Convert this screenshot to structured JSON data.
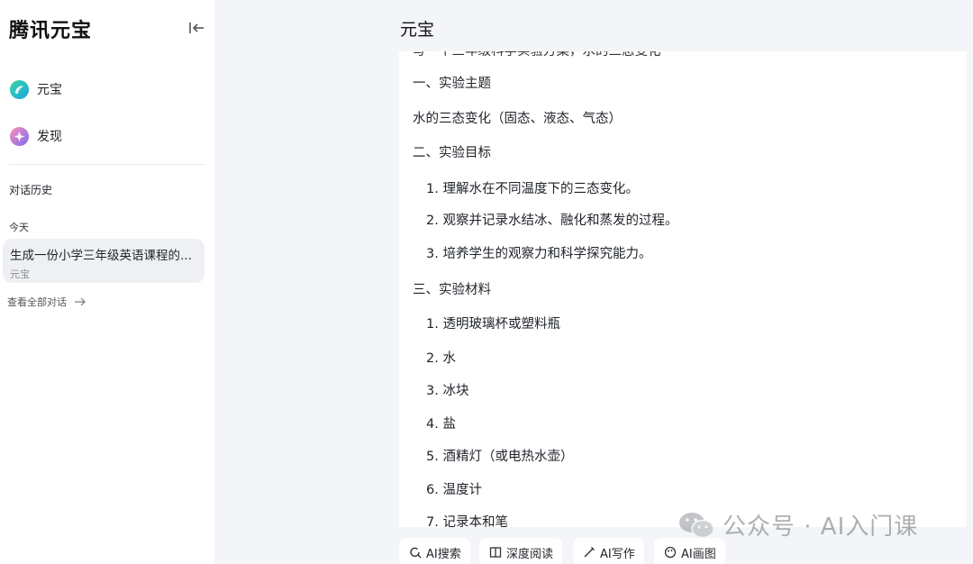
{
  "sidebar": {
    "brand": "腾讯元宝",
    "nav": [
      {
        "label": "元宝"
      },
      {
        "label": "发现"
      }
    ],
    "history_title": "对话历史",
    "today_label": "今天",
    "history_items": [
      {
        "title": "生成一份小学三年级英语课程的...",
        "subtitle": "元宝"
      }
    ],
    "view_all": "查看全部对话"
  },
  "main": {
    "title": "元宝",
    "doc": {
      "cut_line": "写一个三年级科学实验方案，水的三态变化",
      "lines": [
        "一、实验主题",
        "水的三态变化（固态、液态、气态）",
        "二、实验目标",
        "1. 理解水在不同温度下的三态变化。",
        "2. 观察并记录水结冰、融化和蒸发的过程。",
        "3. 培养学生的观察力和科学探究能力。",
        "三、实验材料",
        "1. 透明玻璃杯或塑料瓶",
        "2. 水",
        "3. 冰块",
        "4. 盐",
        "5. 酒精灯（或电热水壶）",
        "6. 温度计",
        "7. 记录本和笔"
      ]
    },
    "tools": [
      {
        "label": "AI搜索",
        "icon": "search-refresh-icon"
      },
      {
        "label": "深度阅读",
        "icon": "book-icon"
      },
      {
        "label": "AI写作",
        "icon": "pen-icon"
      },
      {
        "label": "AI画图",
        "icon": "palette-icon"
      }
    ]
  },
  "watermark": {
    "text": "公众号 · AI入门课",
    "icon": "wechat-icon"
  },
  "colors": {
    "sidebar_bg": "#ffffff",
    "page_bg": "#f3f5f8",
    "history_active_bg": "#eef0f3"
  }
}
